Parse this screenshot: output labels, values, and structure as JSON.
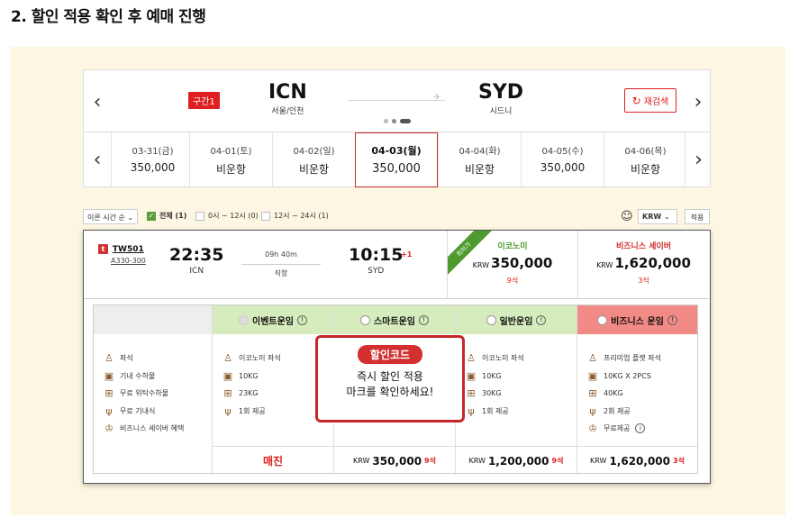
{
  "heading": "2. 할인 적용 확인 후 예매 진행",
  "route": {
    "segment_badge": "구간1",
    "origin_code": "ICN",
    "origin_name": "서울/인천",
    "dest_code": "SYD",
    "dest_name": "시드니",
    "research_label": "재검색"
  },
  "dates": [
    {
      "date": "03-31(금)",
      "price": "350,000"
    },
    {
      "date": "04-01(토)",
      "price": "비운항"
    },
    {
      "date": "04-02(일)",
      "price": "비운항"
    },
    {
      "date": "04-03(월)",
      "price": "350,000",
      "selected": true
    },
    {
      "date": "04-04(화)",
      "price": "비운항"
    },
    {
      "date": "04-05(수)",
      "price": "350,000"
    },
    {
      "date": "04-06(목)",
      "price": "비운항"
    }
  ],
  "filter": {
    "sort_label": "이른 시간 순",
    "all_label": "전체 (1)",
    "am_label": "0시 ~ 12시 (0)",
    "pm_label": "12시 ~ 24시 (1)",
    "currency": "KRW",
    "apply_label": "적용"
  },
  "flight": {
    "flight_no": "TW501",
    "aircraft": "A330-300",
    "dep_time": "22:35",
    "dep_code": "ICN",
    "arr_time": "10:15",
    "arr_code": "SYD",
    "day_plus": "+1",
    "duration": "09h 40m",
    "direct": "직항",
    "ribbon": "최저가",
    "economy": {
      "name": "이코노미",
      "currency": "KRW",
      "price": "350,000",
      "seats": "9석"
    },
    "business": {
      "name": "비즈니스 세이버",
      "currency": "KRW",
      "price": "1,620,000",
      "seats": "3석"
    }
  },
  "features": [
    "좌석",
    "기내 수하물",
    "무료 위탁수하물",
    "무료 기내식",
    "비즈니스 세이버 혜택"
  ],
  "fares": [
    {
      "name": "이벤트운임",
      "items": [
        "이코노미 좌석",
        "10KG",
        "23KG",
        "1회 제공"
      ],
      "footer": "매진",
      "color": "#d6ecbd"
    },
    {
      "name": "스마트운임",
      "items": [],
      "currency": "KRW",
      "price": "350,000",
      "seats": "9석",
      "color": "#d6ecbd"
    },
    {
      "name": "일반운임",
      "items": [
        "이코노미 좌석",
        "10KG",
        "30KG",
        "1회 제공"
      ],
      "currency": "KRW",
      "price": "1,200,000",
      "seats": "9석",
      "color": "#d6ecbd"
    },
    {
      "name": "비즈니스 운임",
      "items": [
        "프리미엄 플랫 좌석",
        "10KG X 2PCS",
        "40KG",
        "2회 제공",
        "무료제공"
      ],
      "currency": "KRW",
      "price": "1,620,000",
      "seats": "3석",
      "color": "#f28b86"
    }
  ],
  "callout": {
    "badge": "할인코드",
    "line1": "즉시 할인 적용",
    "line2": "마크를 확인하세요!"
  }
}
